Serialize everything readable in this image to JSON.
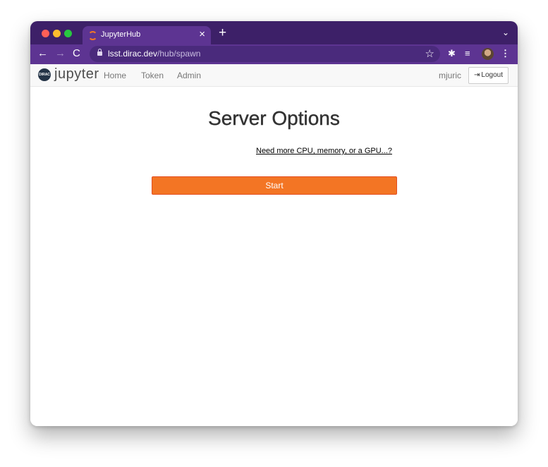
{
  "browser": {
    "tab": {
      "title": "JupyterHub",
      "close_glyph": "×",
      "favicon": "jupyter-favicon-icon"
    },
    "new_tab_glyph": "+",
    "tab_menu_glyph": "⌄",
    "nav": {
      "back": "←",
      "forward": "→",
      "reload": "C"
    },
    "url": {
      "host": "lsst.dirac.dev",
      "path": "/hub/spawn"
    },
    "icons": {
      "star": "☆",
      "extensions": "✱",
      "media": "≡",
      "menu": "⋮"
    }
  },
  "navbar": {
    "logo_text": "DIRAC",
    "brand": "jupyter",
    "links": [
      "Home",
      "Token",
      "Admin"
    ],
    "user": "mjuric",
    "logout_icon": "⇥",
    "logout_label": "Logout"
  },
  "main": {
    "title": "Server Options",
    "more_link": "Need more CPU, memory, or a GPU...?",
    "start_label": "Start"
  },
  "colors": {
    "browser_frame": "#3d2068",
    "browser_toolbar": "#5d3492",
    "start_button": "#f37524"
  }
}
